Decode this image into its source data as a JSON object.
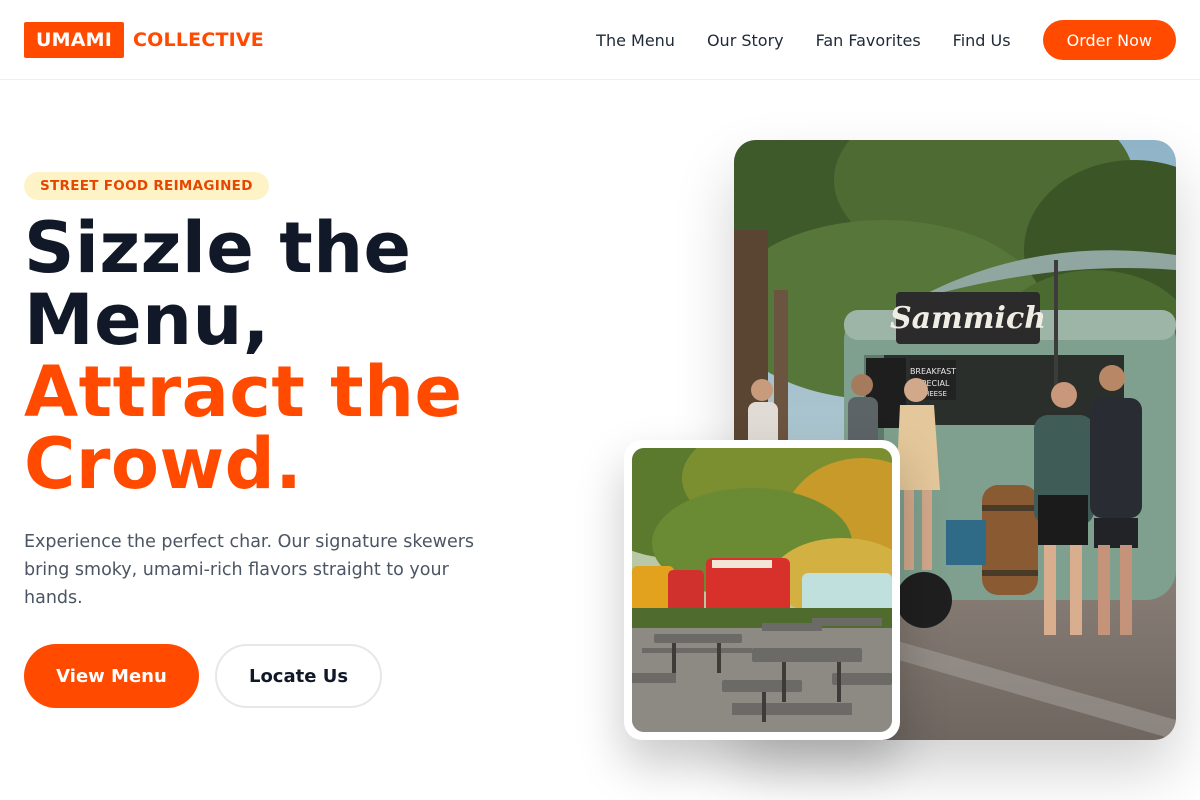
{
  "brand": {
    "name_box": "UMAMI",
    "name_text": "COLLECTIVE",
    "accent_color": "#ff4a00"
  },
  "nav": {
    "links": [
      "The Menu",
      "Our Story",
      "Fan Favorites",
      "Find Us"
    ],
    "cta": "Order Now"
  },
  "hero": {
    "badge": "STREET FOOD REIMAGINED",
    "headline_dark_1": "Sizzle the",
    "headline_dark_2": "Menu,",
    "headline_accent_1": "Attract the",
    "headline_accent_2": "Crowd.",
    "description": "Experience the perfect char. Our signature skewers bring smoky, umami-rich flavors straight to your hands.",
    "primary_button": "View Menu",
    "secondary_button": "Locate Us"
  },
  "photos": {
    "main_sign": "Sammich",
    "main_board_1": "BREAKFAST",
    "main_board_2": "SPECIAL",
    "main_board_3": "CHEESE"
  }
}
